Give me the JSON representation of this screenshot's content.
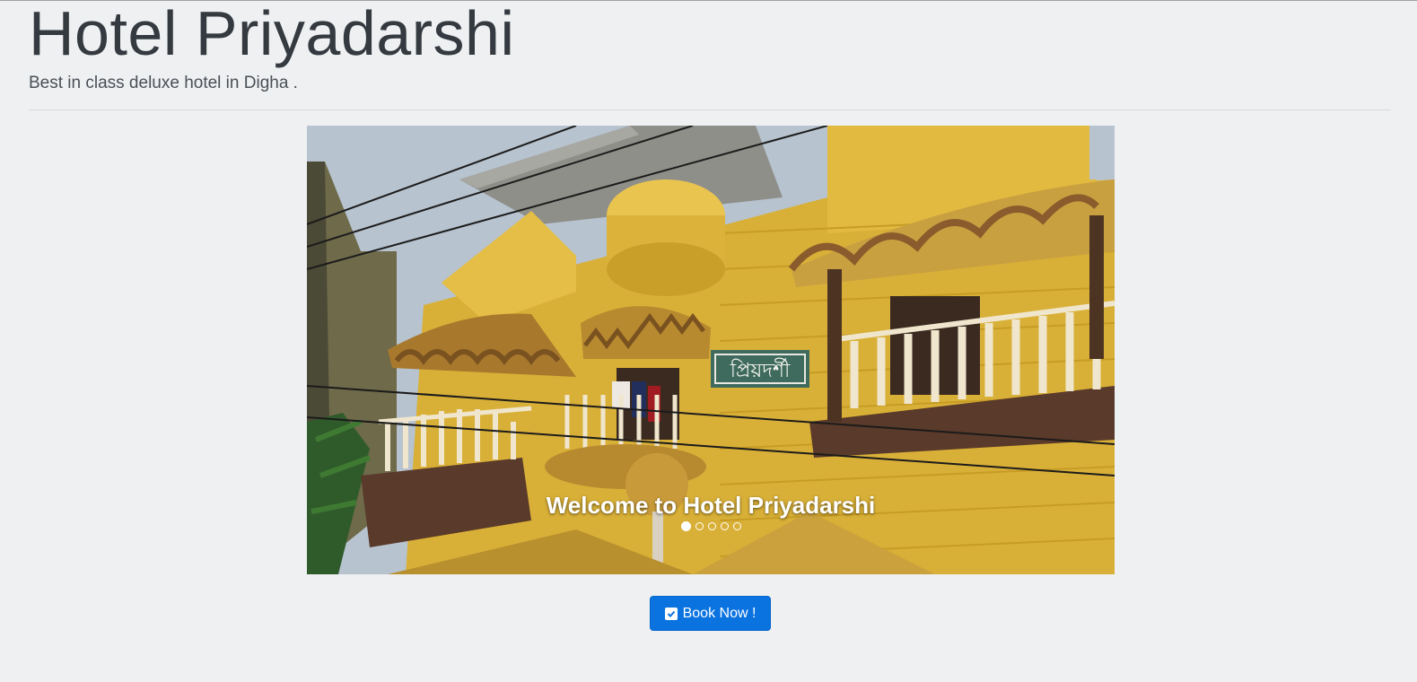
{
  "header": {
    "title": "Hotel Priyadarshi",
    "tagline": "Best in class deluxe hotel in Digha ."
  },
  "carousel": {
    "caption": "Welcome to Hotel Priyadarshi",
    "slide_count": 5,
    "active_slide": 1,
    "sign_text": "প্রিয়দর্শী"
  },
  "cta": {
    "label": "Book Now !",
    "icon": "check-square-icon",
    "color": "#0a73e0"
  }
}
